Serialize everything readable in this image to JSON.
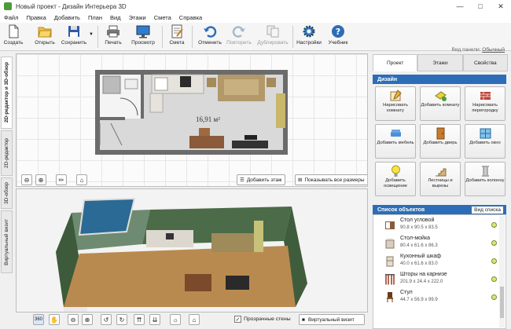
{
  "window": {
    "title": "Новый проект - Дизайн Интерьера 3D"
  },
  "menu": [
    "Файл",
    "Правка",
    "Добавить",
    "План",
    "Вид",
    "Этажи",
    "Смета",
    "Справка"
  ],
  "toolbar": {
    "buttons": [
      {
        "label": "Создать",
        "icon": "new-file-icon"
      },
      {
        "label": "Открыть",
        "icon": "folder-open-icon"
      },
      {
        "label": "Сохранить",
        "icon": "floppy-disk-icon"
      },
      {
        "label": "Печать",
        "icon": "printer-icon"
      },
      {
        "label": "Просмотр",
        "icon": "monitor-icon"
      },
      {
        "label": "Смета",
        "icon": "estimate-icon"
      },
      {
        "label": "Отменить",
        "icon": "undo-icon"
      },
      {
        "label": "Повторить",
        "icon": "redo-icon",
        "disabled": true
      },
      {
        "label": "Дублировать",
        "icon": "duplicate-icon",
        "disabled": true
      },
      {
        "label": "Настройки",
        "icon": "gear-icon"
      },
      {
        "label": "Учебник",
        "icon": "help-icon"
      }
    ],
    "panel_view_label": "Вид панели:",
    "panel_view_value": "Обычный"
  },
  "side_tabs": [
    "2D-редактор и 3D-обзор",
    "2D-редактор",
    "3D-обзор",
    "Виртуальный визит"
  ],
  "plan": {
    "area_text": "16,91 м²",
    "add_floor": "Добавить этаж",
    "show_sizes": "Показывать все размеры"
  },
  "view3d": {
    "transparent_walls": "Прозрачные стены",
    "virtual_visit": "Виртуальный визит"
  },
  "right_panel": {
    "tabs": [
      "Проект",
      "Этажи",
      "Свойства"
    ],
    "section_title": "Дизайн",
    "design_buttons": [
      {
        "label": "Нарисовать комнату",
        "icon": "draw-room-icon"
      },
      {
        "label": "Добавить комнату",
        "icon": "add-room-icon"
      },
      {
        "label": "Нарисовать перегородку",
        "icon": "partition-icon"
      },
      {
        "label": "Добавить мебель",
        "icon": "furniture-icon"
      },
      {
        "label": "Добавить дверь",
        "icon": "door-icon"
      },
      {
        "label": "Добавить окно",
        "icon": "window-icon"
      },
      {
        "label": "Добавить освещение",
        "icon": "lightbulb-icon"
      },
      {
        "label": "Лестницы и вырезы",
        "icon": "stairs-icon"
      },
      {
        "label": "Добавить колонну",
        "icon": "column-icon"
      }
    ],
    "objects_title": "Список объектов",
    "list_view": "Вид списка",
    "objects": [
      {
        "name": "Стол угловой",
        "dims": "90.8 x 90.5 x 83.5"
      },
      {
        "name": "Стол-мойка",
        "dims": "80.4 x 61.6 x 86.3"
      },
      {
        "name": "Кухонный шкаф",
        "dims": "40.0 x 61.6 x 83.0"
      },
      {
        "name": "Шторы на карнизе",
        "dims": "201.9 x 24.4 x 222.0"
      },
      {
        "name": "Стул",
        "dims": "44.7 x 56.9 x 99.9"
      }
    ]
  }
}
